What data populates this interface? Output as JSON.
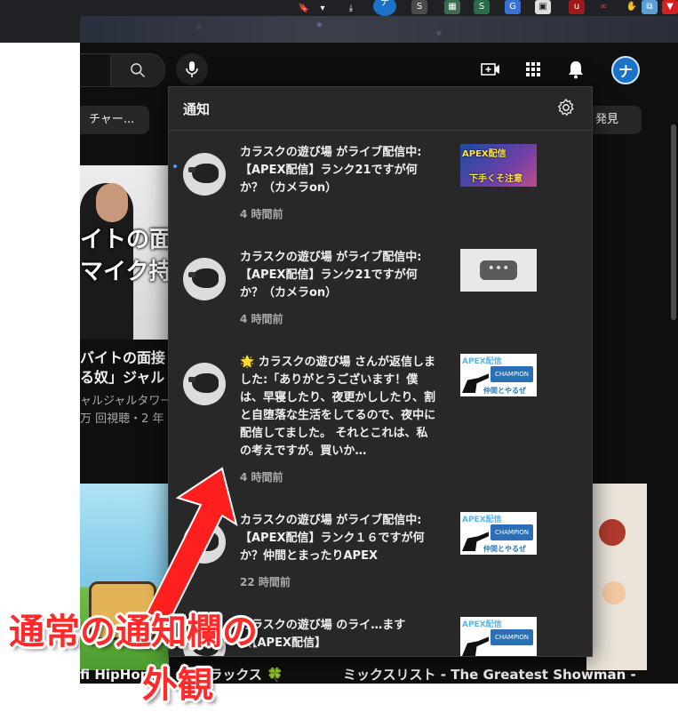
{
  "colors": {
    "accent_blue": "#3ea6ff",
    "annotation_red": "#ff2a2a",
    "panel_bg": "#282828",
    "page_bg": "#0f0f0f"
  },
  "browser": {
    "extension_icons": [
      "bookmark-icon",
      "download-icon",
      "profile-icon",
      "s-extension-icon",
      "grid-extension-icon",
      "s-extension-icon",
      "translate-icon",
      "window-icon",
      "ublock-icon",
      "glasses-icon",
      "hand-icon",
      "extensions-icon",
      "shield-icon"
    ]
  },
  "header": {
    "search_icon": "search-icon",
    "mic_icon": "mic-icon",
    "create_icon": "create-icon",
    "apps_icon": "apps-grid-icon",
    "bell_icon": "bell-icon",
    "avatar_letter": "ナ"
  },
  "chips": [
    "チャー...",
    "発見"
  ],
  "feed": {
    "video1": {
      "thumb_overlay_1": "イトの面",
      "thumb_overlay_2": "マイク持",
      "title_1": "バイトの面接",
      "title_2": "る奴」ジャル",
      "channel": "ャルジャルタワー",
      "meta": "万 回視聴・2 年"
    },
    "video2": {
      "title": "fi HipHop",
      "title_suffix": "リラックス 🍀"
    },
    "video3": {
      "title": "ミックスリスト - The Greatest Showman -"
    }
  },
  "notifications": {
    "title": "通知",
    "items": [
      {
        "text": "カラスクの遊び場 がライブ配信中: 【APEX配信】ランク21ですが何か？（カメラon）",
        "time": "4 時間前",
        "thumb": "apex-a",
        "thumb_text_1": "APEX配信",
        "thumb_text_2": "下手くそ注意"
      },
      {
        "text": "カラスクの遊び場 がライブ配信中: 【APEX配信】ランク21ですが何か？（カメラon）",
        "time": "4 時間前",
        "thumb": "placeholder",
        "thumb_text_1": "•••"
      },
      {
        "text": "🌟 カラスクの遊び場 さんが返信しました:「ありがとうございます！僕は、早寝したり、夜更かししたり、割と自堕落な生活をしてるので、夜中に配信してました。 それとこれは、私の考えですが。買いか…",
        "time": "4 時間前",
        "thumb": "apex-c",
        "thumb_text_1": "APEX配信",
        "thumb_text_2": "仲間とやるぜ"
      },
      {
        "text": "カラスクの遊び場 がライブ配信中: 【APEX配信】ランク１６ですが何か？仲間とまったりAPEX",
        "time": "22 時間前",
        "thumb": "apex-c",
        "thumb_text_1": "APEX配信",
        "thumb_text_2": "仲間とやるぜ"
      },
      {
        "text": "カラスクの遊び場 のライ…ます（【APEX配信】",
        "time": "",
        "thumb": "apex-c",
        "thumb_text_1": "APEX配信",
        "thumb_text_2": ""
      }
    ]
  },
  "annotation": {
    "line1": "通常の通知欄の",
    "line2": "外観"
  }
}
